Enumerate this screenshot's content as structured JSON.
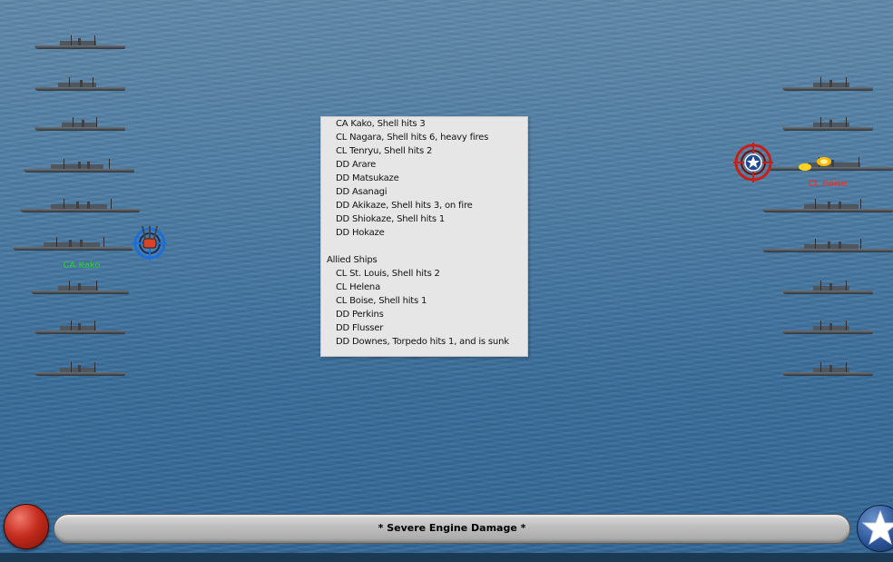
{
  "battle_log": {
    "lines": [
      {
        "text": "CA Kako, Shell hits 3",
        "kind": "indent"
      },
      {
        "text": "CL Nagara, Shell hits 6,  heavy fires",
        "kind": "indent"
      },
      {
        "text": "CL Tenryu, Shell hits 2",
        "kind": "indent"
      },
      {
        "text": "DD Arare",
        "kind": "indent"
      },
      {
        "text": "DD Matsukaze",
        "kind": "indent"
      },
      {
        "text": "DD Asanagi",
        "kind": "indent"
      },
      {
        "text": "DD Akikaze, Shell hits 3,  on fire",
        "kind": "indent"
      },
      {
        "text": "DD Shiokaze, Shell hits 1",
        "kind": "indent"
      },
      {
        "text": "DD Hokaze",
        "kind": "indent"
      },
      {
        "text": "",
        "kind": "blank"
      },
      {
        "text": "Allied Ships",
        "kind": "header"
      },
      {
        "text": "CL St. Louis, Shell hits 2",
        "kind": "indent"
      },
      {
        "text": "CL Helena",
        "kind": "indent"
      },
      {
        "text": "CL Boise, Shell hits 1",
        "kind": "indent"
      },
      {
        "text": "DD Perkins",
        "kind": "indent"
      },
      {
        "text": "DD Flusser",
        "kind": "indent"
      },
      {
        "text": "DD Downes, Torpedo hits 1, and is sunk",
        "kind": "indent"
      }
    ]
  },
  "japanese_fleet": {
    "ship_count": 9,
    "selected_label": "CA Kako",
    "label_color": "#26d426"
  },
  "allied_fleet": {
    "ship_count": 8,
    "target_label": "CL Boise",
    "label_color": "#ff2a1a"
  },
  "status_bar": {
    "message": "* Severe Engine Damage *"
  },
  "colors": {
    "sea": "#3e6f9a",
    "panel_bg": "#e6e6e6",
    "japan_button": "#c42c1e",
    "allied_button": "#2b559a"
  },
  "icons": {
    "japan_button": "red-circle-icon",
    "allied_button": "white-star-roundel-icon",
    "enemy_reticle": "crosshair-reticle-icon",
    "friendly_reticle": "turret-reticle-icon",
    "gunfire": "muzzle-flash-icon"
  }
}
